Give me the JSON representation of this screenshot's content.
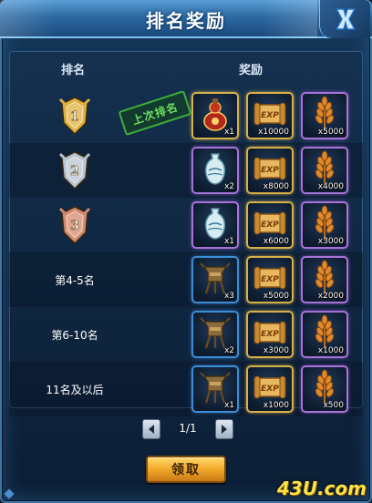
{
  "window": {
    "title": "排名奖励",
    "close_icon": "close-x-icon"
  },
  "columns": {
    "rank": "排名",
    "reward": "奖励"
  },
  "last_rank_stamp": "上次排名",
  "rows": [
    {
      "rank_type": "badge",
      "rank_label": "1",
      "badge_color": "#e0b13e",
      "items": [
        {
          "icon": "gourd-bottle-icon",
          "qty": "x1",
          "frame": "gold"
        },
        {
          "icon": "exp-scroll-icon",
          "qty": "x10000",
          "frame": "gold"
        },
        {
          "icon": "wheat-icon",
          "qty": "x5000",
          "frame": "purple"
        }
      ]
    },
    {
      "rank_type": "badge",
      "rank_label": "2",
      "badge_color": "#b9c4d0",
      "items": [
        {
          "icon": "porcelain-vase-icon",
          "qty": "x2",
          "frame": "purple"
        },
        {
          "icon": "exp-scroll-icon",
          "qty": "x8000",
          "frame": "gold"
        },
        {
          "icon": "wheat-icon",
          "qty": "x4000",
          "frame": "purple"
        }
      ]
    },
    {
      "rank_type": "badge",
      "rank_label": "3",
      "badge_color": "#d48a6e",
      "items": [
        {
          "icon": "porcelain-vase-icon",
          "qty": "x1",
          "frame": "purple"
        },
        {
          "icon": "exp-scroll-icon",
          "qty": "x6000",
          "frame": "gold"
        },
        {
          "icon": "wheat-icon",
          "qty": "x3000",
          "frame": "purple"
        }
      ]
    },
    {
      "rank_type": "text",
      "rank_label": "第4-5名",
      "items": [
        {
          "icon": "bronze-vessel-icon",
          "qty": "x3",
          "frame": "blue"
        },
        {
          "icon": "exp-scroll-icon",
          "qty": "x5000",
          "frame": "gold"
        },
        {
          "icon": "wheat-icon",
          "qty": "x2000",
          "frame": "purple"
        }
      ]
    },
    {
      "rank_type": "text",
      "rank_label": "第6-10名",
      "items": [
        {
          "icon": "bronze-vessel-icon",
          "qty": "x2",
          "frame": "blue"
        },
        {
          "icon": "exp-scroll-icon",
          "qty": "x3000",
          "frame": "gold"
        },
        {
          "icon": "wheat-icon",
          "qty": "x1000",
          "frame": "purple"
        }
      ]
    },
    {
      "rank_type": "text",
      "rank_label": "11名及以后",
      "items": [
        {
          "icon": "bronze-vessel-icon",
          "qty": "x1",
          "frame": "blue"
        },
        {
          "icon": "exp-scroll-icon",
          "qty": "x1000",
          "frame": "gold"
        },
        {
          "icon": "wheat-icon",
          "qty": "x500",
          "frame": "purple"
        }
      ]
    }
  ],
  "pager": {
    "page_text": "1/1",
    "prev_icon": "arrow-left-icon",
    "next_icon": "arrow-right-icon"
  },
  "claim_button": "领取",
  "watermark": "43U.com"
}
